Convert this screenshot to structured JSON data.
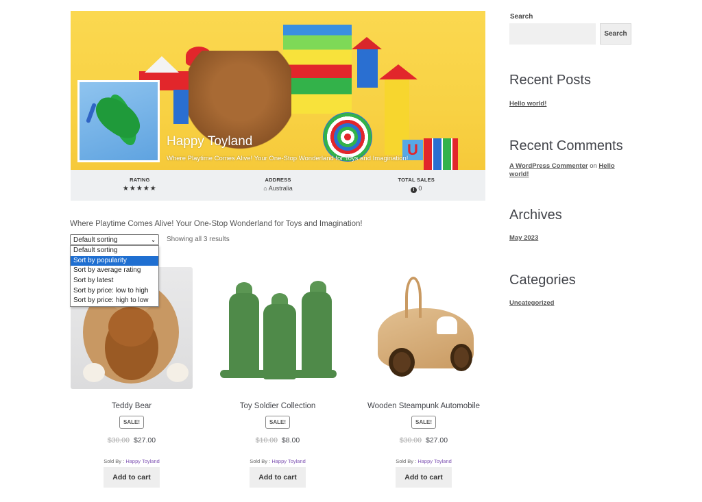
{
  "store": {
    "name": "Happy Toyland",
    "tagline": "Where Playtime Comes Alive! Your One-Stop Wonderland for Toys and Imagination!",
    "stats": [
      {
        "label": "RATING",
        "value": "★★★★★",
        "icon": "star-icon"
      },
      {
        "label": "ADDRESS",
        "value": "Australia",
        "icon": "home-icon"
      },
      {
        "label": "TOTAL SALES",
        "value": "0",
        "icon": "info-icon"
      }
    ],
    "rating_stars": 5,
    "description": "Where Playtime Comes Alive! Your One-Stop Wonderland for Toys and Imagination!"
  },
  "sorting": {
    "selected": "Default sorting",
    "result_count": "Showing all 3 results",
    "options": [
      {
        "label": "Default sorting",
        "highlighted": false
      },
      {
        "label": "Sort by popularity",
        "highlighted": true
      },
      {
        "label": "Sort by average rating",
        "highlighted": false
      },
      {
        "label": "Sort by latest",
        "highlighted": false
      },
      {
        "label": "Sort by price: low to high",
        "highlighted": false
      },
      {
        "label": "Sort by price: high to low",
        "highlighted": false
      }
    ]
  },
  "products": [
    {
      "title": "Teddy Bear",
      "badge": "SALE!",
      "old_price": "$30.00",
      "price": "$27.00",
      "sold_by_label": "Sold By :",
      "vendor": "Happy Toyland",
      "button": "Add to cart"
    },
    {
      "title": "Toy Soldier Collection",
      "badge": "SALE!",
      "old_price": "$10.00",
      "price": "$8.00",
      "sold_by_label": "Sold By :",
      "vendor": "Happy Toyland",
      "button": "Add to cart"
    },
    {
      "title": "Wooden Steampunk Automobile",
      "badge": "SALE!",
      "old_price": "$30.00",
      "price": "$27.00",
      "sold_by_label": "Sold By :",
      "vendor": "Happy Toyland",
      "button": "Add to cart"
    }
  ],
  "sidebar": {
    "search_label": "Search",
    "search_value": "",
    "search_button": "Search",
    "recent_posts": {
      "heading": "Recent Posts",
      "items": [
        "Hello world!"
      ]
    },
    "recent_comments": {
      "heading": "Recent Comments",
      "author": "A WordPress Commenter",
      "on": "on",
      "post": "Hello world!"
    },
    "archives": {
      "heading": "Archives",
      "items": [
        "May 2023"
      ]
    },
    "categories": {
      "heading": "Categories",
      "items": [
        "Uncategorized"
      ]
    }
  },
  "colors": {
    "banner_yellow": "#fbd850",
    "stats_bg": "#eef0f2",
    "highlight_blue": "#1f6fd1",
    "vendor_link": "#7f54b3",
    "button_bg": "#eeeeee"
  }
}
